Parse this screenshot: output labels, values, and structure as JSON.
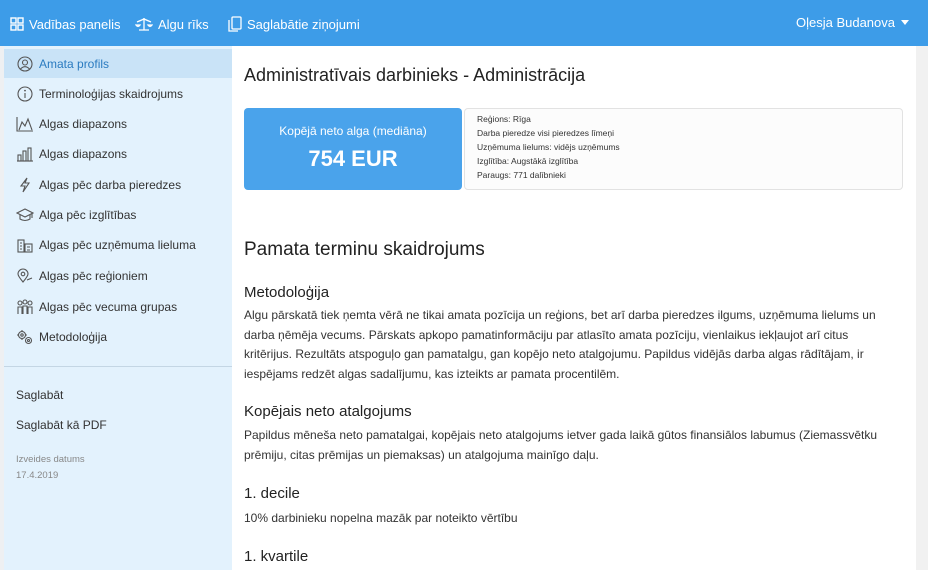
{
  "topbar": {
    "nav": [
      {
        "label": "Vadības panelis",
        "icon": "grid-icon"
      },
      {
        "label": "Algu rīks",
        "icon": "scale-icon"
      },
      {
        "label": "Saglabātie ziņojumi",
        "icon": "copy-icon"
      }
    ],
    "user": "Oļesja Budanova"
  },
  "sidebar": {
    "items": [
      {
        "label": "Amata profils",
        "icon": "user-circle-icon",
        "active": true
      },
      {
        "label": "Terminoloģijas skaidrojums",
        "icon": "info-icon"
      },
      {
        "label": "Algas diapazons",
        "icon": "area-chart-icon"
      },
      {
        "label": "Algas diapazons",
        "icon": "bar-chart-icon"
      },
      {
        "label": "Algas pēc darba pieredzes",
        "icon": "lightning-icon"
      },
      {
        "label": "Alga pēc izglītības",
        "icon": "graduation-cap-icon"
      },
      {
        "label": "Algas pēc uzņēmuma lieluma",
        "icon": "building-icon"
      },
      {
        "label": "Algas pēc reģioniem",
        "icon": "map-pin-icon"
      },
      {
        "label": "Algas pēc vecuma grupas",
        "icon": "people-icon"
      },
      {
        "label": "Metodoloģija",
        "icon": "gears-icon"
      }
    ],
    "save": "Saglabāt",
    "save_pdf": "Saglabāt kā PDF",
    "created_label": "Izveides datums",
    "created_date": "17.4.2019"
  },
  "main": {
    "title": "Administratīvais darbinieks - Administrācija",
    "salary_label": "Kopējā neto alga (mediāna)",
    "salary_value": "754 EUR",
    "info": [
      "Reģions: Rīga",
      "Darba pieredze visi pieredzes līmeņi",
      "Uzņēmuma lielums: vidējs uzņēmums",
      "Izglītība: Augstākā izglītība",
      "Paraugs: 771 dalībnieki"
    ],
    "section_title": "Pamata terminu skaidrojums",
    "methodology_title": "Metodoloģija",
    "methodology_text": "Algu pārskatā tiek ņemta vērā ne tikai amata pozīcija un reģions, bet arī darba pieredzes ilgums, uzņēmuma lielums un darba ņēmēja vecums. Pārskats apkopo pamatinformāciju par atlasīto amata pozīciju, vienlaikus iekļaujot arī citus kritērijus. Rezultāts atspoguļo gan pamatalgu, gan kopējo neto atalgojumu. Papildus vidējās darba algas rādītājam, ir iespējams redzēt algas sadalījumu, kas izteikts ar pamata procentilēm.",
    "total_title": "Kopējais neto atalgojums",
    "total_text": "Papildus mēneša neto pamatalgai, kopējais neto atalgojums ietver gada laikā gūtos finansiālos labumus (Ziemassvētku prēmiju, citas prēmijas un piemaksas) un atalgojuma mainīgo daļu.",
    "decile_title": "1. decile",
    "decile_text": "10% darbinieku nopelna mazāk par noteikto vērtību",
    "quartile_title": "1. kvartile"
  }
}
